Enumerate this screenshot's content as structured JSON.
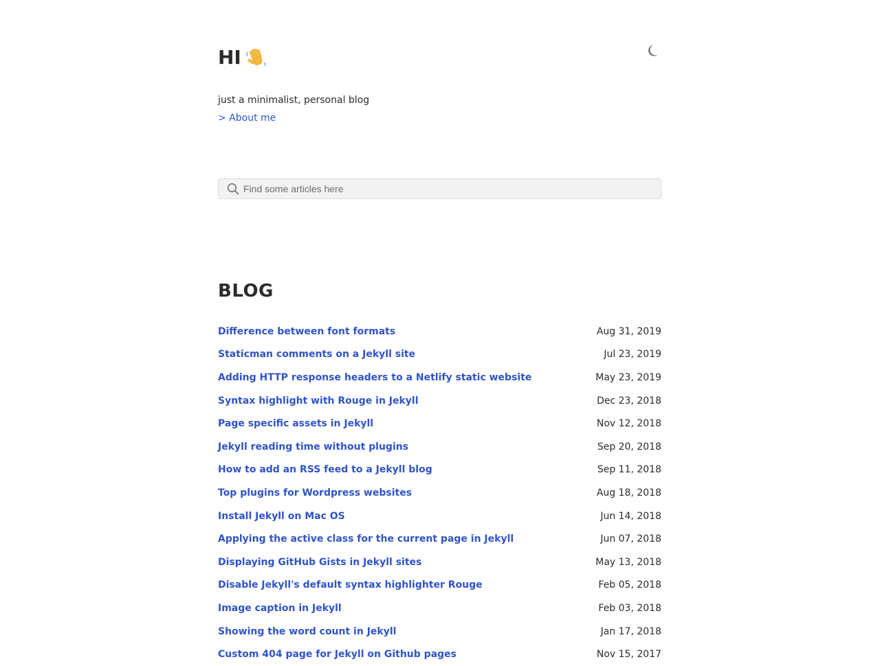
{
  "header": {
    "greeting": "HI",
    "wave_emoji_icon": "waving-hand-icon",
    "theme_toggle_icon": "moon-icon",
    "tagline": "just a minimalist, personal blog",
    "about_link": "> About me"
  },
  "search": {
    "placeholder": "Find some articles here",
    "icon": "search-icon"
  },
  "blog": {
    "title": "BLOG",
    "posts": [
      {
        "title": "Difference between font formats",
        "date": "Aug 31, 2019"
      },
      {
        "title": "Staticman comments on a Jekyll site",
        "date": "Jul 23, 2019"
      },
      {
        "title": "Adding HTTP response headers to a Netlify static website",
        "date": "May 23, 2019"
      },
      {
        "title": "Syntax highlight with Rouge in Jekyll",
        "date": "Dec 23, 2018"
      },
      {
        "title": "Page specific assets in Jekyll",
        "date": "Nov 12, 2018"
      },
      {
        "title": "Jekyll reading time without plugins",
        "date": "Sep 20, 2018"
      },
      {
        "title": "How to add an RSS feed to a Jekyll blog",
        "date": "Sep 11, 2018"
      },
      {
        "title": "Top plugins for Wordpress websites",
        "date": "Aug 18, 2018"
      },
      {
        "title": "Install Jekyll on Mac OS",
        "date": "Jun 14, 2018"
      },
      {
        "title": "Applying the active class for the current page in Jekyll",
        "date": "Jun 07, 2018"
      },
      {
        "title": "Displaying GitHub Gists in Jekyll sites",
        "date": "May 13, 2018"
      },
      {
        "title": "Disable Jekyll's default syntax highlighter Rouge",
        "date": "Feb 05, 2018"
      },
      {
        "title": "Image caption in Jekyll",
        "date": "Feb 03, 2018"
      },
      {
        "title": "Showing the word count in Jekyll",
        "date": "Jan 17, 2018"
      },
      {
        "title": "Custom 404 page for Jekyll on Github pages",
        "date": "Nov 15, 2017"
      }
    ]
  },
  "colors": {
    "link": "#2f54c9",
    "text": "#2b2b2b",
    "search_bg": "#f2f2f2",
    "moon": "#7a7e8c"
  }
}
